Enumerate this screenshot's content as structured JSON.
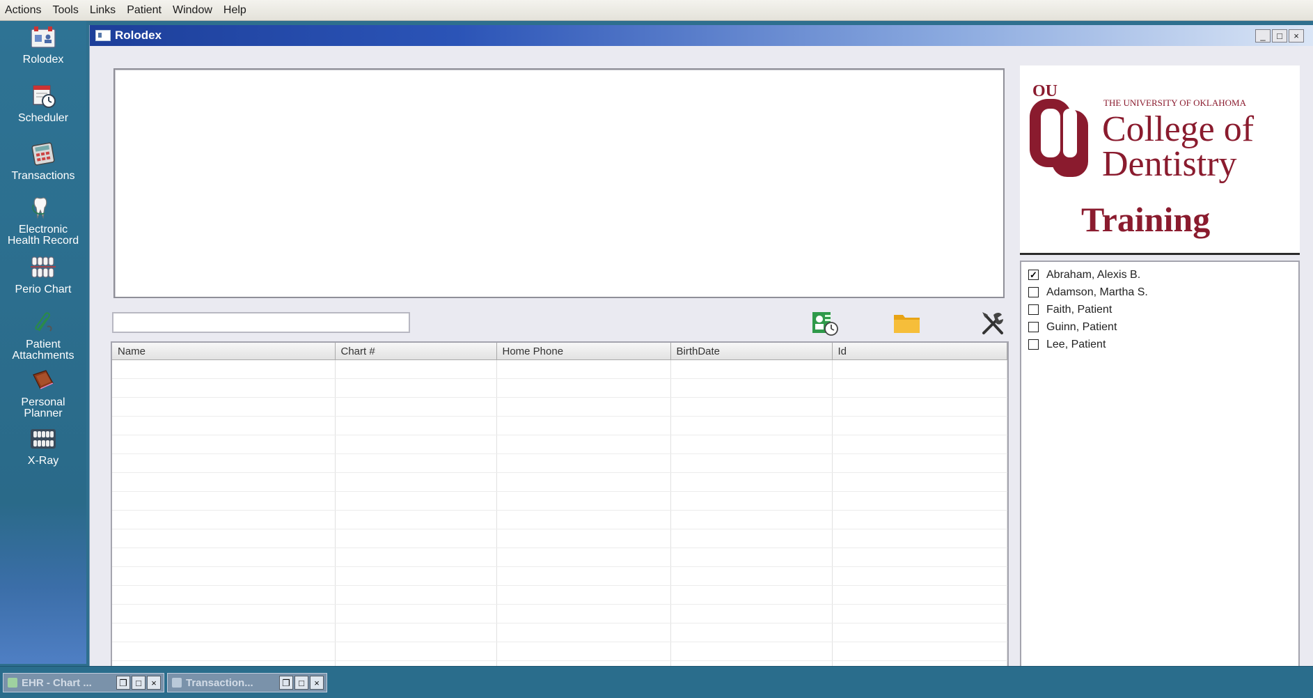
{
  "menu": [
    "Actions",
    "Tools",
    "Links",
    "Patient",
    "Window",
    "Help"
  ],
  "sidebar": {
    "items": [
      {
        "label": "Rolodex",
        "icon": "rolodex-icon"
      },
      {
        "label": "Scheduler",
        "icon": "calendar-clock-icon"
      },
      {
        "label": "Transactions",
        "icon": "calculator-icon"
      },
      {
        "label": "Electronic\nHealth Record",
        "icon": "tooth-stethoscope-icon"
      },
      {
        "label": "Perio Chart",
        "icon": "teeth-chart-icon"
      },
      {
        "label": "Patient\nAttachments",
        "icon": "paperclip-icon"
      },
      {
        "label": "Personal\nPlanner",
        "icon": "planner-book-icon"
      },
      {
        "label": "X-Ray",
        "icon": "xray-teeth-icon"
      }
    ]
  },
  "window": {
    "title": "Rolodex",
    "buttons": {
      "minimize": "_",
      "maximize": "□",
      "close": "×"
    }
  },
  "search": {
    "value": "",
    "placeholder": ""
  },
  "toolbar": {
    "icons": [
      "patient-schedule-icon",
      "folder-icon",
      "tools-icon"
    ]
  },
  "grid": {
    "columns": [
      "Name",
      "Chart #",
      "Home Phone",
      "BirthDate",
      "Id"
    ],
    "rows": []
  },
  "logo": {
    "line1": "THE UNIVERSITY OF OKLAHOMA",
    "line2": "College of",
    "line3": "Dentistry",
    "line4": "Training",
    "mark": "OU",
    "color": "#8a1b2e"
  },
  "patients": [
    {
      "name": "Abraham, Alexis B.",
      "checked": true
    },
    {
      "name": "Adamson, Martha S.",
      "checked": false
    },
    {
      "name": "Faith, Patient",
      "checked": false
    },
    {
      "name": "Guinn, Patient",
      "checked": false
    },
    {
      "name": "Lee, Patient",
      "checked": false
    }
  ],
  "taskbar": [
    {
      "label": "EHR - Chart ...",
      "restore": "❐",
      "maximize": "□",
      "close": "×"
    },
    {
      "label": "Transaction...",
      "restore": "❐",
      "maximize": "□",
      "close": "×"
    }
  ]
}
